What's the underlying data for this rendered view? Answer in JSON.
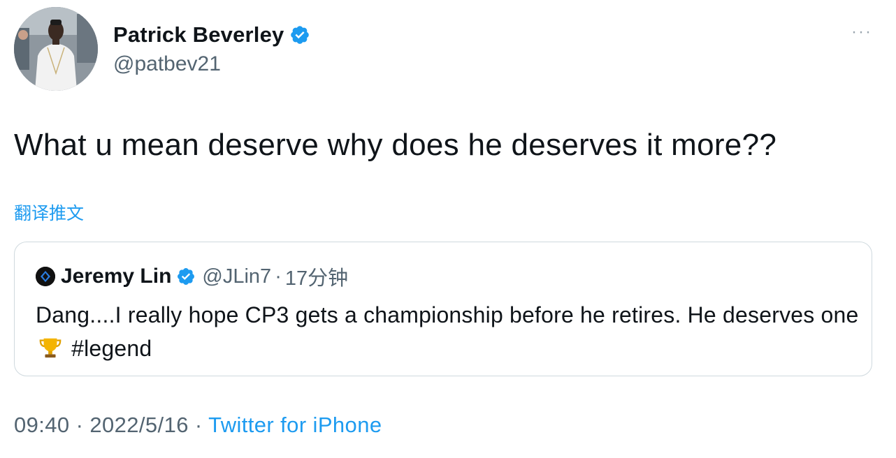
{
  "author": {
    "display_name": "Patrick Beverley",
    "handle": "@patbev21",
    "verified": true,
    "avatar_icon": "profile-photo"
  },
  "menu": {
    "more_icon": "ellipsis-icon",
    "more_glyph": "···"
  },
  "tweet": {
    "text": "What u mean deserve why does he deserves it more??",
    "translate_label": "翻译推文"
  },
  "quoted_tweet": {
    "author_name": "Jeremy Lin",
    "handle": "@JLin7",
    "separator": "·",
    "time": "17分钟",
    "verified": true,
    "text_before_emoji": "Dang....I really hope CP3 gets a championship before he retires. He deserves one",
    "emoji_icon": "trophy-icon",
    "hashtag": "#legend"
  },
  "footer": {
    "time": "09:40",
    "separator": "·",
    "date": "2022/5/16",
    "source": "Twitter for iPhone"
  },
  "colors": {
    "accent": "#1d9bf0",
    "secondary_text": "#536471",
    "primary_text": "#0f1419",
    "border": "#cfd9de"
  }
}
